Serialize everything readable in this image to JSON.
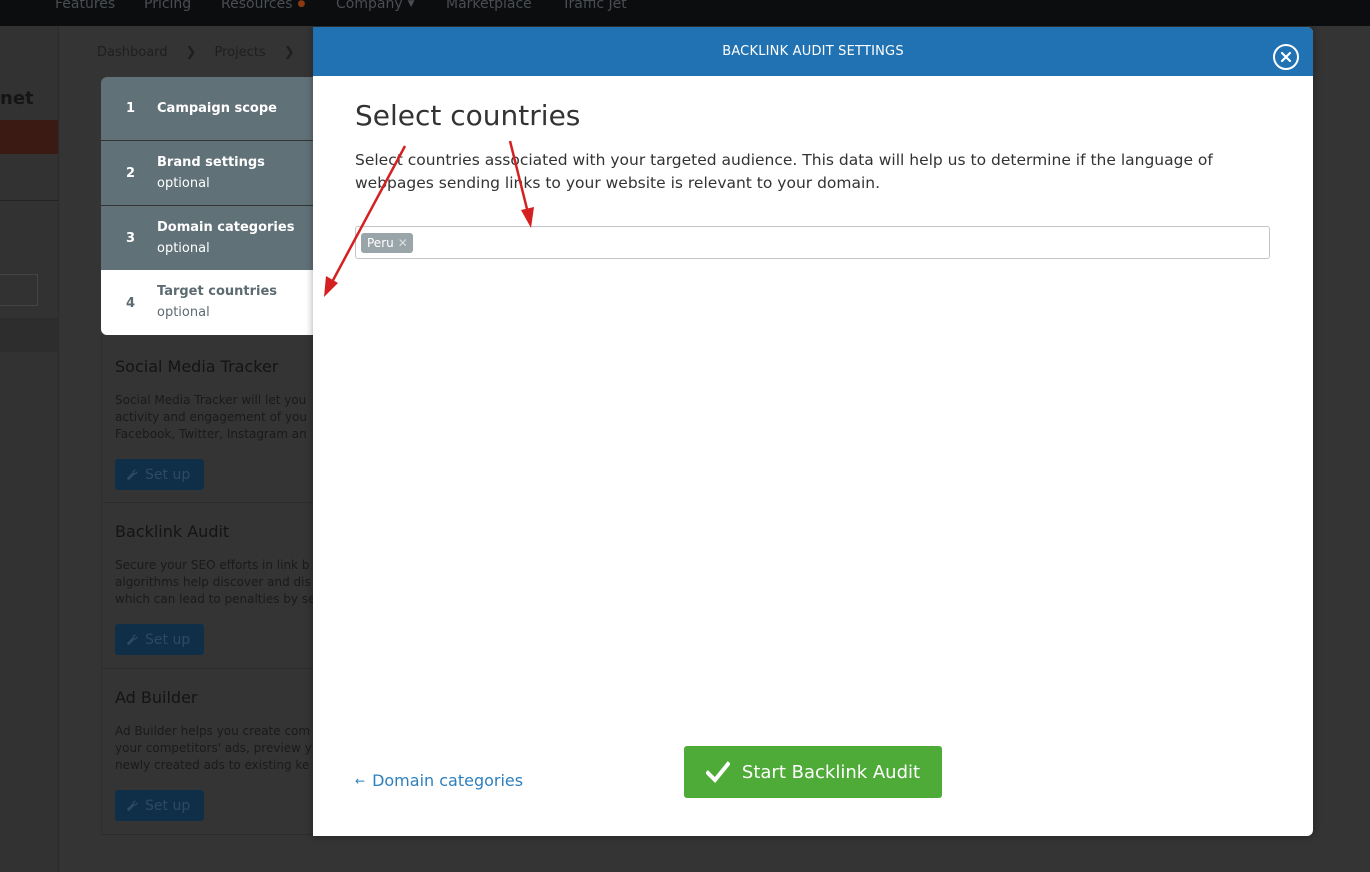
{
  "topnav": {
    "items": [
      "Features",
      "Pricing",
      "Resources",
      "Company",
      "Marketplace",
      "Traffic Jet"
    ]
  },
  "left_pane": {
    "brand_fragment": "net"
  },
  "breadcrumb": [
    "Dashboard",
    "Projects"
  ],
  "cards": [
    {
      "title": "Social Media Tracker",
      "description": [
        "Social Media Tracker will let you",
        "activity and engagement of you",
        "Facebook, Twitter, Instagram an"
      ],
      "button": "Set up"
    },
    {
      "title": "Backlink Audit",
      "description": [
        "Secure your SEO efforts in link b",
        "algorithms help discover and dis",
        "which can lead to penalties by se"
      ],
      "button": "Set up"
    },
    {
      "title": "Ad Builder",
      "description": [
        "Ad Builder helps you create com",
        "your competitors' ads, preview y",
        "newly created ads to existing ke"
      ],
      "button": "Set up"
    }
  ],
  "steps": [
    {
      "num": "1",
      "title": "Campaign scope",
      "sub": ""
    },
    {
      "num": "2",
      "title": "Brand settings",
      "sub": "optional"
    },
    {
      "num": "3",
      "title": "Domain categories",
      "sub": "optional"
    },
    {
      "num": "4",
      "title": "Target countries",
      "sub": "optional",
      "active": true
    }
  ],
  "modal": {
    "title": "BACKLINK AUDIT SETTINGS",
    "heading": "Select countries",
    "description": "Select countries associated with your targeted audience. This data will help us to determine if the language of webpages sending links to your website is relevant to your domain.",
    "selected_countries": [
      "Peru"
    ],
    "back_link": "Domain categories",
    "start_button": "Start Backlink Audit"
  },
  "colors": {
    "header_blue": "#2172b3",
    "start_green": "#4eab38",
    "link_blue": "#2d7fbd",
    "step_gray": "#617178",
    "annotation_red": "#d42020"
  }
}
